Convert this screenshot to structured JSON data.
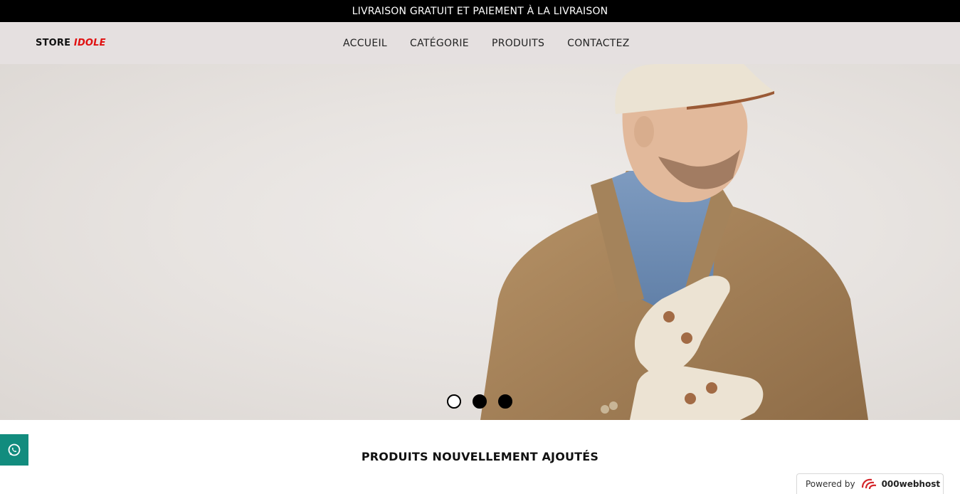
{
  "announcement": "LIVRAISON GRATUIT ET PAIEMENT À LA LIVRAISON",
  "logo": {
    "part1": "STORE ",
    "part2": "IDOLE"
  },
  "nav": [
    "ACCUEIL",
    "CATÉGORIE",
    "PRODUITS",
    "CONTACTEZ"
  ],
  "hero": {
    "slide_count": 3,
    "active_slide": 1
  },
  "section_title": "PRODUITS NOUVELLEMENT AJOUTÉS",
  "floating_button": {
    "icon": "whatsapp-icon"
  },
  "powered": {
    "prefix": "Powered by",
    "brand": "000webhost"
  },
  "colors": {
    "topbar": "#000000",
    "header": "#e5e0e0",
    "logo_accent": "#e01010",
    "whatsapp": "#128c7e"
  }
}
